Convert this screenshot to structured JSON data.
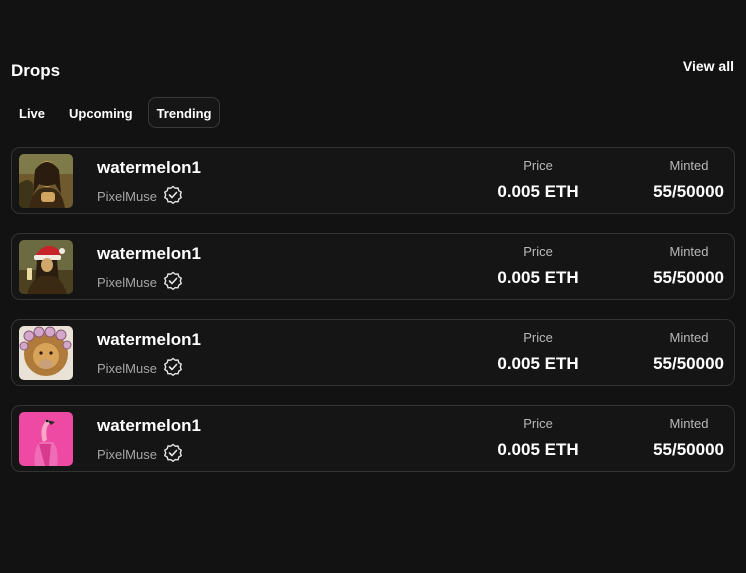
{
  "header": {
    "title": "Drops",
    "view_all": "View all"
  },
  "tabs": [
    {
      "label": "Live",
      "active": false
    },
    {
      "label": "Upcoming",
      "active": false
    },
    {
      "label": "Trending",
      "active": true
    }
  ],
  "drops": [
    {
      "name": "watermelon1",
      "creator": "PixelMuse",
      "verified": true,
      "price_label": "Price",
      "price": "0.005 ETH",
      "minted_label": "Minted",
      "minted": "55/50000",
      "thumbnail": "mona-lisa-icon"
    },
    {
      "name": "watermelon1",
      "creator": "PixelMuse",
      "verified": true,
      "price_label": "Price",
      "price": "0.005 ETH",
      "minted_label": "Minted",
      "minted": "55/50000",
      "thumbnail": "mona-lisa-santa-icon"
    },
    {
      "name": "watermelon1",
      "creator": "PixelMuse",
      "verified": true,
      "price_label": "Price",
      "price": "0.005 ETH",
      "minted_label": "Minted",
      "minted": "55/50000",
      "thumbnail": "lion-curlers-icon"
    },
    {
      "name": "watermelon1",
      "creator": "PixelMuse",
      "verified": true,
      "price_label": "Price",
      "price": "0.005 ETH",
      "minted_label": "Minted",
      "minted": "55/50000",
      "thumbnail": "flamingo-pink-icon"
    }
  ],
  "colors": {
    "background": "#121212",
    "card_border": "#333333",
    "muted_text": "#a6a6a6"
  }
}
